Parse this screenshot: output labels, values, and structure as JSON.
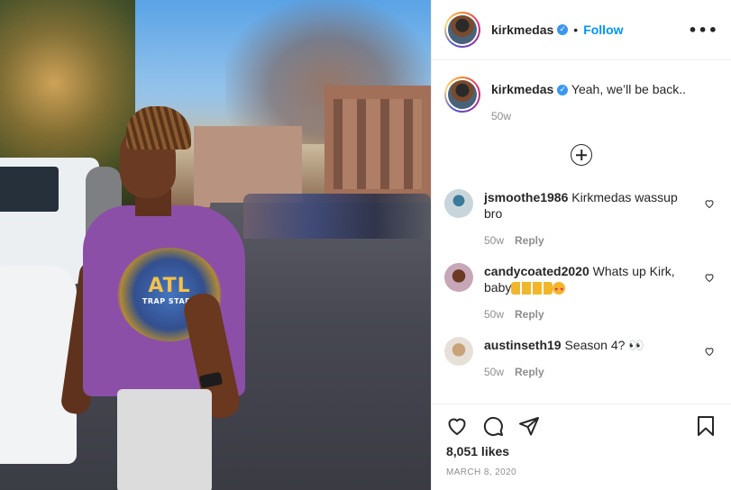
{
  "header": {
    "username": "kirkmedas",
    "verified_badge": "✓",
    "separator": "•",
    "follow_label": "Follow",
    "more_icon": "•••"
  },
  "photo": {
    "shirt_text": "ATL",
    "shirt_subtext": "TRAP STARS"
  },
  "caption": {
    "username": "kirkmedas",
    "verified_badge": "✓",
    "text": "Yeah, we’ll be back..",
    "time": "50w"
  },
  "load_more_icon": "plus-circle-icon",
  "comments": [
    {
      "username": "jsmoothe1986",
      "text": "Kirkmedas wassup bro",
      "time": "50w",
      "reply": "Reply"
    },
    {
      "username": "candycoated2020",
      "text": "Whats up Kirk, baby",
      "time": "50w",
      "reply": "Reply"
    },
    {
      "username": "austinseth19",
      "text": "Season 4? 👀",
      "time": "50w",
      "reply": "Reply"
    }
  ],
  "actions": {
    "likes": "8,051 likes",
    "date": "MARCH 8, 2020"
  },
  "colors": {
    "follow": "#0095f6",
    "verified": "#3897f0",
    "muted": "#8e8e8e"
  }
}
